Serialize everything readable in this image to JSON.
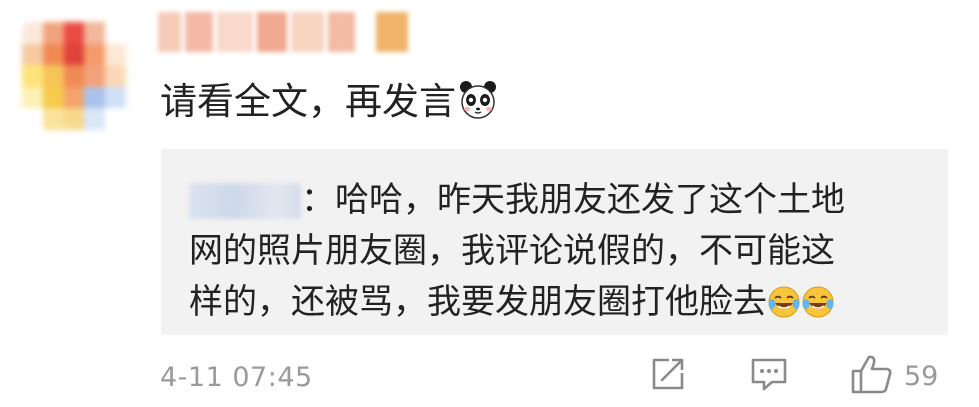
{
  "comment": {
    "text": "请看全文，再发言",
    "emoji": "panda-face-icon"
  },
  "quote": {
    "line1": "：哈哈，昨天我朋友还发了这个土地",
    "line2": "网的照片朋友圈，我评论说假的，不可能这",
    "line3": "样的，还被骂，我要发朋友圈打他脸去",
    "emojis": [
      "laugh-cry-icon",
      "laugh-cry-icon"
    ]
  },
  "footer": {
    "timestamp": "4-11 07:45",
    "like_count": "59"
  },
  "colors": {
    "text": "#222222",
    "meta": "#9a9a9a",
    "quote_bg": "#f2f2f2"
  }
}
